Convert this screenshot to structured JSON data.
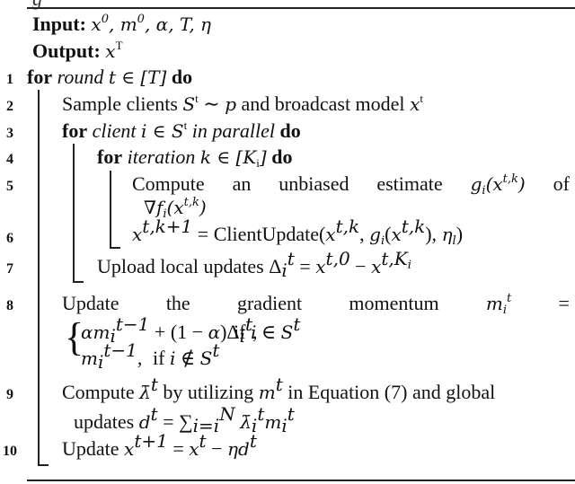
{
  "algorithm": {
    "caption_fragment": "g",
    "input_label": "Input:",
    "input_vars": "x⁰, m⁰, α, T, η",
    "output_label": "Output:",
    "output_var": "x",
    "output_sup": "T",
    "lines": [
      {
        "num": "1",
        "kw_for": "for",
        "italic": "round",
        "math": "t ∈ [T]",
        "kw_do": "do"
      },
      {
        "num": "2",
        "text": "Sample clients ",
        "math_a": "S",
        "sup_a": "t",
        "mid": " ∼ ",
        "math_b": "p",
        "text_b": " and broadcast model ",
        "math_c": "x",
        "sup_c": "t"
      },
      {
        "num": "3",
        "kw_for": "for",
        "italic": "client",
        "math": "i ∈ S",
        "sup": "t",
        "italic_b": "in parallel",
        "kw_do": "do"
      },
      {
        "num": "4",
        "kw_for": "for",
        "italic": "iteration",
        "math": "k ∈ [K",
        "sub": "i",
        "math_end": "]",
        "kw_do": "do"
      },
      {
        "num": "5",
        "words": [
          "Compute",
          "an",
          "unbiased",
          "estimate",
          "g_i(x^{t,k})",
          "of"
        ],
        "cont": "∇f_i(x^{t,k})"
      },
      {
        "num": "6",
        "text": "x^{t,k+1} = ClientUpdate(x^{t,k}, g_i(x^{t,k}), η_l)"
      },
      {
        "num": "7",
        "text": "Upload local updates ",
        "math": "Δ_i^t = x^{t,0} − x^{t,K_i}"
      },
      {
        "num": "8",
        "words": [
          "Update",
          "the",
          "gradient",
          "momentum",
          "m_i^t",
          "="
        ],
        "case1": "αm_i^{t−1} + (1 − α)Δ_i^t,",
        "cond1": "if i ∈ S^t",
        "case2": "m_i^{t−1},",
        "cond2": "if i ∉ S^t"
      },
      {
        "num": "9",
        "text": "Compute λ̄^t by utilizing m^t in Equation (7) and global",
        "cont": "updates d^t = Σ_{i=i}^N λ̄_i^t m_i^t"
      },
      {
        "num": "10",
        "text": "Update x^{t+1} = x^t − ηd^t"
      }
    ]
  }
}
